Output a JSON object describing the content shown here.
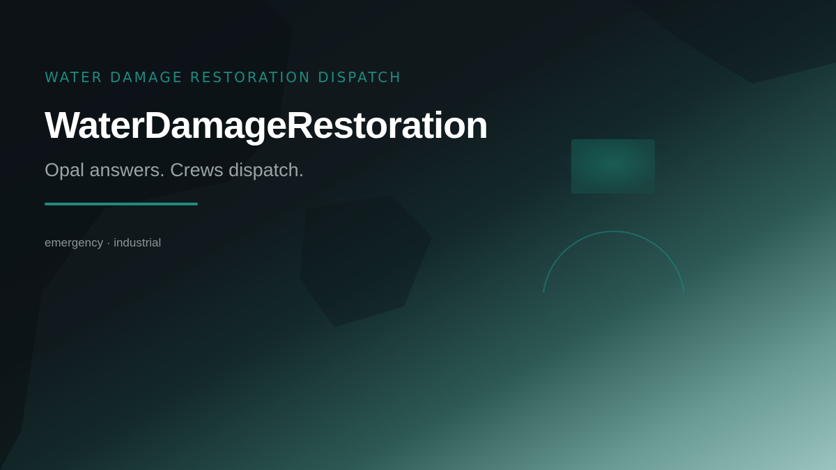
{
  "hero": {
    "eyebrow": "WATER DAMAGE RESTORATION DISPATCH",
    "title": "WaterDamageRestoration",
    "tagline": "Opal answers. Crews dispatch.",
    "tags": "emergency · industrial"
  },
  "colors": {
    "accent": "#1f8a7d",
    "title": "#ffffff",
    "tagline": "#9aa3a6",
    "tags": "#8b9497"
  }
}
